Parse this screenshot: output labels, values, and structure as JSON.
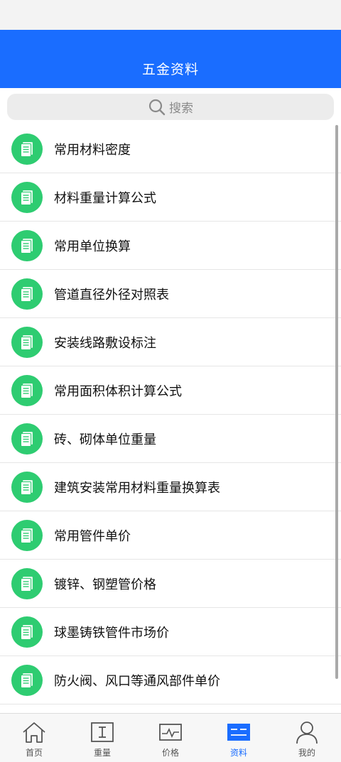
{
  "header": {
    "title": "五金资料"
  },
  "search": {
    "placeholder": "搜索"
  },
  "list": {
    "items": [
      "常用材料密度",
      "材料重量计算公式",
      "常用单位换算",
      "管道直径外径对照表",
      "安装线路敷设标注",
      "常用面积体积计算公式",
      "砖、砌体单位重量",
      "建筑安装常用材料重量换算表",
      "常用管件单价",
      "镀锌、钢塑管价格",
      "球墨铸铁管件市场价",
      "防火阀、风口等通风部件单价"
    ]
  },
  "tabs": [
    {
      "label": "首页",
      "icon": "home-icon"
    },
    {
      "label": "重量",
      "icon": "weight-icon"
    },
    {
      "label": "价格",
      "icon": "price-chart-icon"
    },
    {
      "label": "资料",
      "icon": "data-icon",
      "active": true
    },
    {
      "label": "我的",
      "icon": "user-icon"
    }
  ],
  "colors": {
    "accent": "#1a6dff",
    "item_icon_bg": "#2ecc71"
  }
}
